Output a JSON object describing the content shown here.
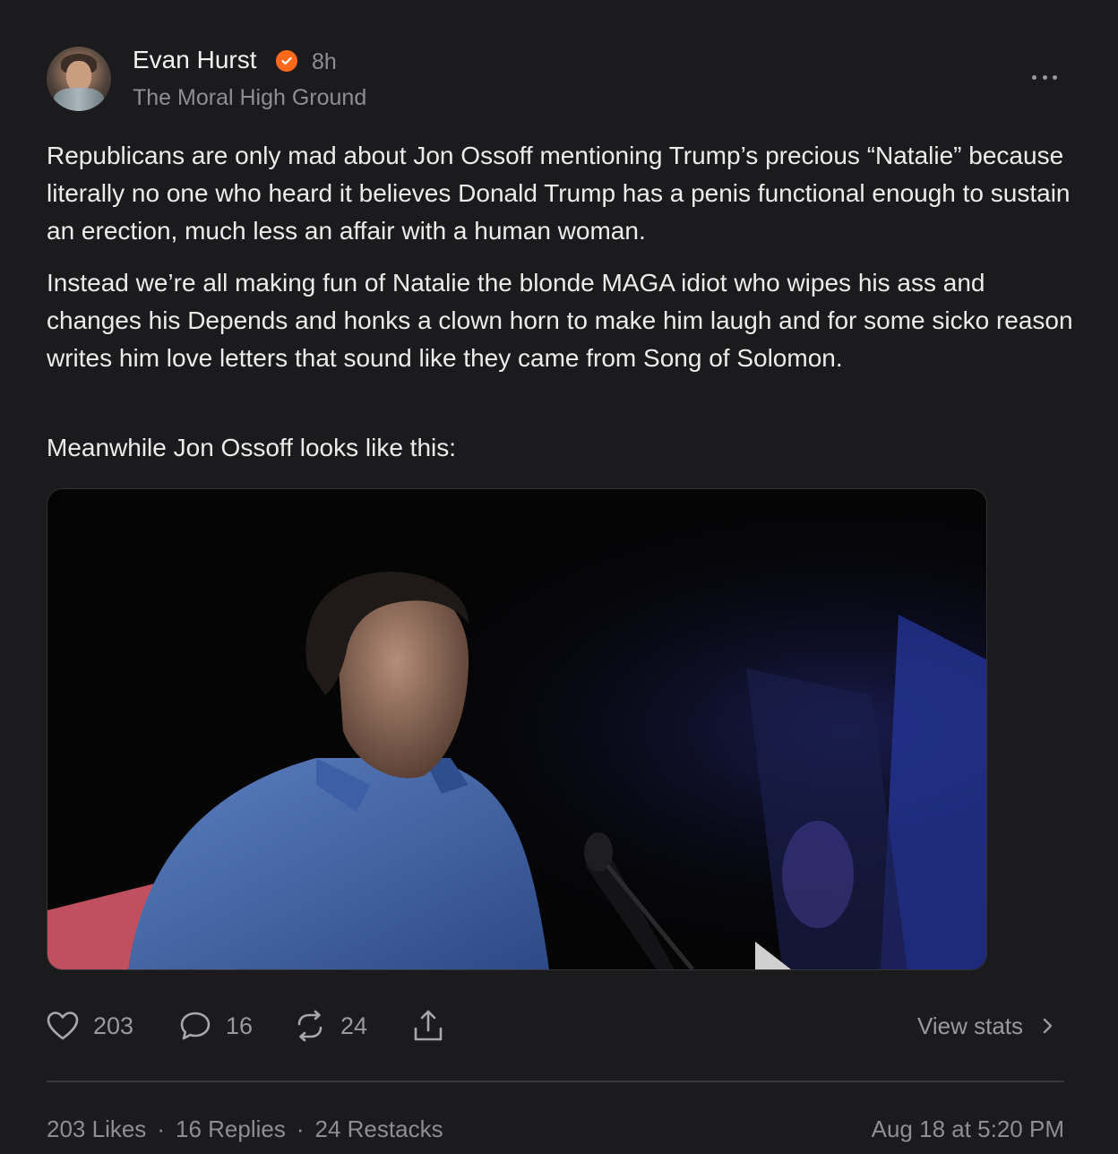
{
  "author": {
    "name": "Evan Hurst",
    "time_ago": "8h",
    "publication": "The Moral High Ground"
  },
  "post": {
    "paragraphs": [
      "Republicans are only mad about Jon Ossoff mentioning Trump’s precious “Natalie” because literally no one who heard it believes Donald Trump has a penis functional enough to sustain an erection, much less an affair with a human woman.",
      "Instead we’re all making fun of Natalie the blonde MAGA idiot who wipes his ass and changes his Depends and honks a clown horn to make him laugh and for some sicko reason writes him love letters that sound like they came from Song of Solomon.",
      "Meanwhile Jon Ossoff looks like this:"
    ]
  },
  "actions": {
    "likes": "203",
    "replies": "16",
    "restacks": "24",
    "view_stats": "View stats"
  },
  "footer": {
    "likes_text": "203 Likes",
    "replies_text": "16 Replies",
    "restacks_text": "24 Restacks",
    "separator": "·",
    "date": "Aug 18 at 5:20 PM"
  },
  "colors": {
    "background": "#1b1b1d",
    "accent": "#ff6719",
    "muted": "#8e8e93"
  },
  "icons": [
    "verified-badge-icon",
    "more-options-icon",
    "heart-icon",
    "comment-icon",
    "restack-icon",
    "share-icon",
    "chevron-right-icon"
  ]
}
